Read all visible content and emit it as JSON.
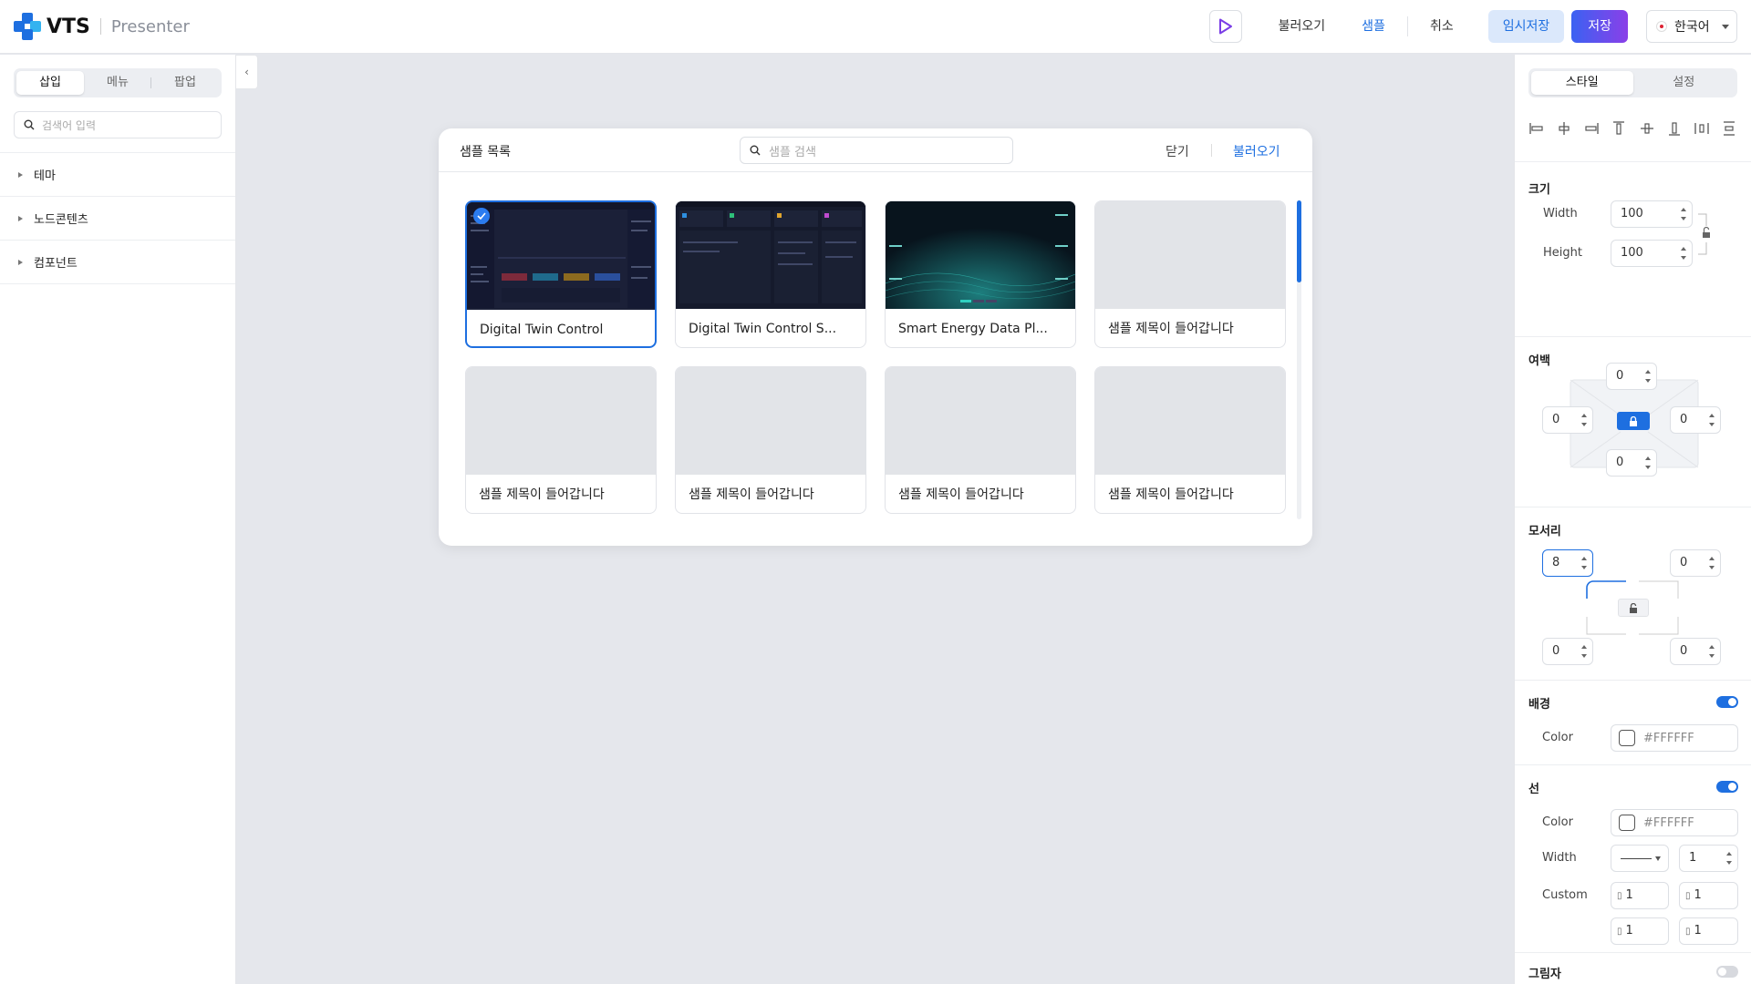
{
  "app": {
    "logo_text": "VTS",
    "subtitle": "Presenter"
  },
  "header": {
    "load": "불러오기",
    "sample": "샘플",
    "cancel": "취소",
    "temp_save": "임시저장",
    "save": "저장",
    "language": "한국어"
  },
  "left_panel": {
    "tabs": [
      "삽입",
      "메뉴",
      "팝업"
    ],
    "active_tab": "삽입",
    "search_placeholder": "검색어 입력",
    "tree": [
      "테마",
      "노드콘텐츠",
      "컴포넌트"
    ]
  },
  "modal": {
    "title": "샘플 목록",
    "search_placeholder": "샘플 검색",
    "close": "닫기",
    "load": "불러오기",
    "cards": [
      {
        "title": "Digital Twin Control",
        "selected": true
      },
      {
        "title": "Digital Twin Control S...",
        "selected": false
      },
      {
        "title": "Smart Energy Data Pl...",
        "selected": false
      },
      {
        "title": "샘플 제목이 들어갑니다",
        "selected": false
      },
      {
        "title": "샘플 제목이 들어갑니다",
        "selected": false
      },
      {
        "title": "샘플 제목이 들어갑니다",
        "selected": false
      },
      {
        "title": "샘플 제목이 들어갑니다",
        "selected": false
      },
      {
        "title": "샘플 제목이 들어갑니다",
        "selected": false
      }
    ]
  },
  "right_panel": {
    "tabs": [
      "스타일",
      "설정"
    ],
    "active_tab": "스타일",
    "size": {
      "title": "크기",
      "width_label": "Width",
      "width": "100",
      "height_label": "Height",
      "height": "100"
    },
    "padding": {
      "title": "여백",
      "top": "0",
      "left": "0",
      "right": "0",
      "bottom": "0"
    },
    "corner": {
      "title": "모서리",
      "top_left": "8",
      "top_right": "0",
      "bottom_left": "0",
      "bottom_right": "0"
    },
    "background": {
      "title": "배경",
      "enabled": true,
      "color_label": "Color",
      "color": "#FFFFFF"
    },
    "border": {
      "title": "선",
      "enabled": true,
      "color_label": "Color",
      "color": "#FFFFFF",
      "width_label": "Width",
      "width": "1",
      "custom_label": "Custom",
      "custom": [
        "1",
        "1",
        "1",
        "1"
      ]
    },
    "shadow": {
      "title": "그림자",
      "enabled": false
    }
  },
  "colors": {
    "accent": "#1E6FE0",
    "save_gradient_start": "#3B62F2",
    "save_gradient_end": "#8A3FE8"
  }
}
